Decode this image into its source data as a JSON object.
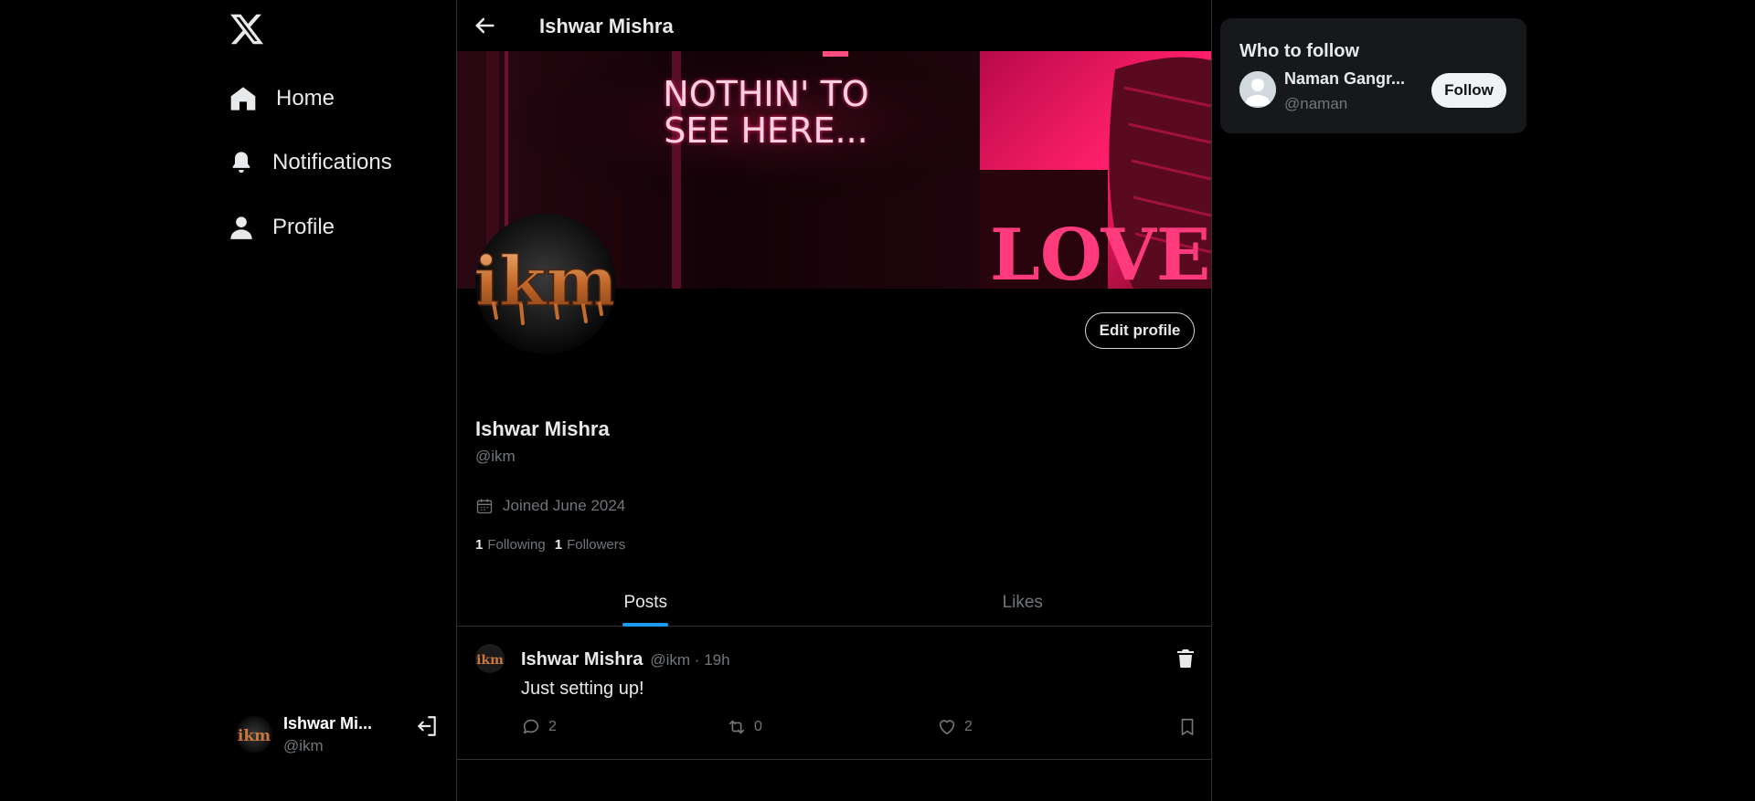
{
  "app": {
    "logo_icon": "x-logo-icon"
  },
  "nav": {
    "items": [
      {
        "label": "Home",
        "icon": "home-icon"
      },
      {
        "label": "Notifications",
        "icon": "bell-icon"
      },
      {
        "label": "Profile",
        "icon": "user-icon"
      }
    ]
  },
  "account": {
    "name": "Ishwar Mi...",
    "handle": "@ikm",
    "logout_icon": "logout-icon"
  },
  "header": {
    "title": "Ishwar Mishra",
    "back_icon": "arrow-left-icon"
  },
  "banner": {
    "neon_line1": "NOTHIN' TO",
    "neon_line2": "SEE HERE...",
    "wall_text": "LOVE"
  },
  "profile": {
    "avatar_text": "ikm",
    "edit_label": "Edit profile",
    "name": "Ishwar Mishra",
    "handle": "@ikm",
    "joined": "Joined June 2024",
    "following_count": "1",
    "following_label": "Following",
    "followers_count": "1",
    "followers_label": "Followers"
  },
  "tabs": [
    {
      "label": "Posts",
      "active": true
    },
    {
      "label": "Likes",
      "active": false
    }
  ],
  "posts": [
    {
      "name": "Ishwar Mishra",
      "meta": "@ikm · 19h",
      "text": "Just setting up!",
      "replies": "2",
      "reposts": "0",
      "likes": "2"
    }
  ],
  "who_to_follow": {
    "title": "Who to follow",
    "users": [
      {
        "name": "Naman Gangr...",
        "handle": "@naman",
        "button": "Follow"
      }
    ]
  },
  "colors": {
    "accent": "#1d9bf0",
    "background": "#000000",
    "muted": "#71767b",
    "neon": "#ff2a6d"
  }
}
